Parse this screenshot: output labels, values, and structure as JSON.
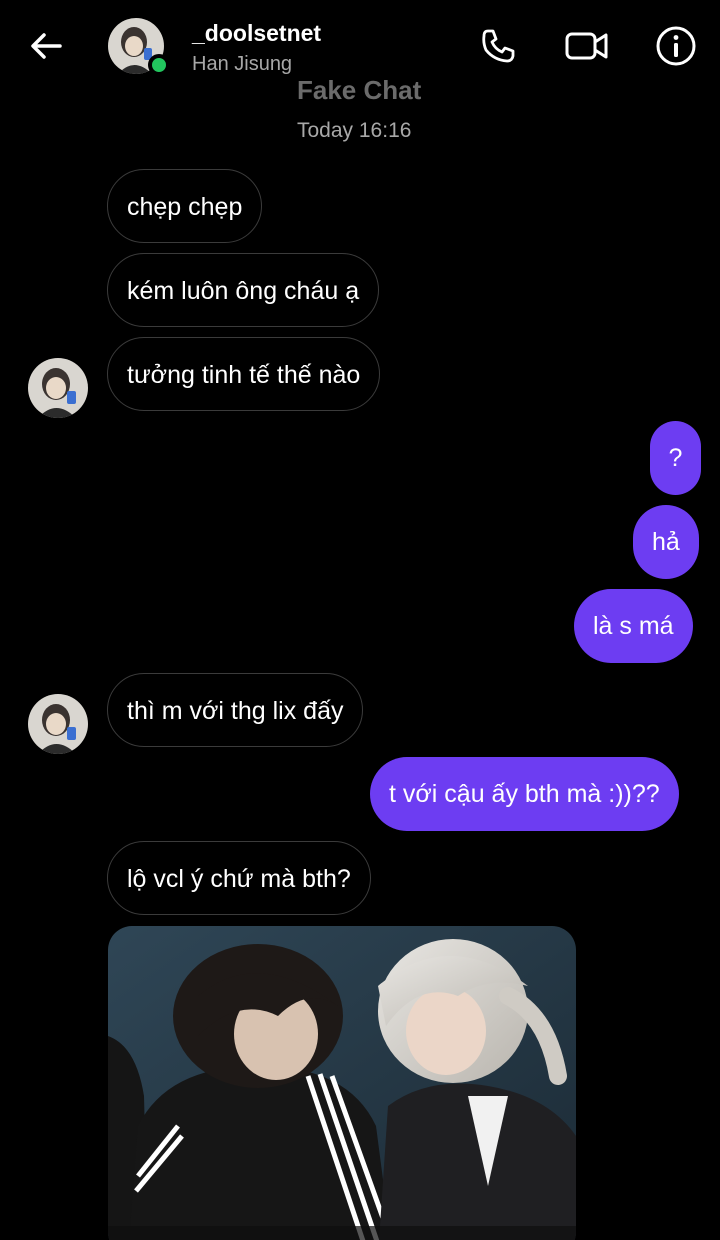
{
  "header": {
    "username": "_doolsetnet",
    "display_name": "Han Jisung",
    "back_icon": "arrow-left-icon",
    "call_icon": "phone-icon",
    "video_icon": "video-camera-icon",
    "info_icon": "info-icon",
    "online_color": "#22c55e"
  },
  "watermark": "Fake Chat",
  "timestamp": "Today 16:16",
  "colors": {
    "outgoing_bubble": "#6d3df2",
    "incoming_border": "#3b3b3b",
    "background": "#000000"
  },
  "messages": [
    {
      "text": "chẹp chẹp",
      "from": "them"
    },
    {
      "text": "kém luôn ông cháu ạ",
      "from": "them"
    },
    {
      "text": "tưởng tinh tế thế nào",
      "from": "them"
    },
    {
      "text": "?",
      "from": "me"
    },
    {
      "text": "hả",
      "from": "me"
    },
    {
      "text": "là s má",
      "from": "me"
    },
    {
      "text": "thì m với thg lix đấy",
      "from": "them"
    },
    {
      "text": "t với cậu ấy bth mà :))??",
      "from": "me"
    },
    {
      "text": "lộ vcl ý chứ mà bth?",
      "from": "them"
    }
  ]
}
